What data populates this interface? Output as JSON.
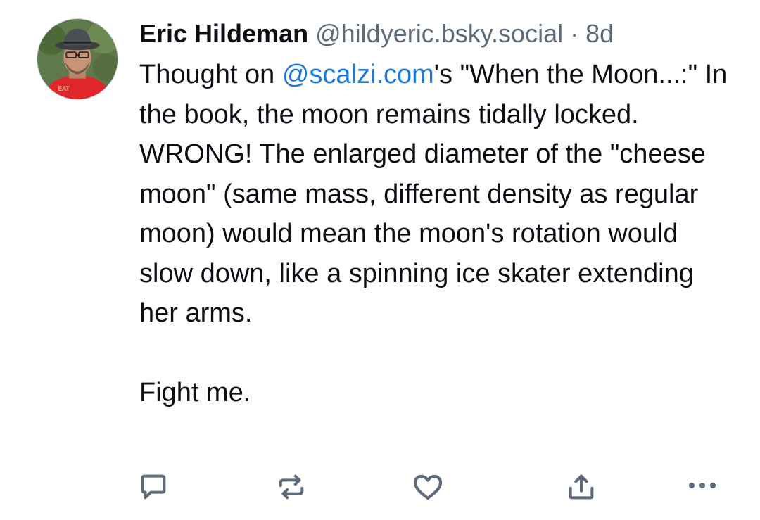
{
  "post": {
    "author": {
      "display_name": "Eric Hildeman",
      "handle": "@hildyeric.bsky.social",
      "separator": "·",
      "time": "8d"
    },
    "body": {
      "part1": "Thought on ",
      "mention": "@scalzi.com",
      "part2": "'s \"When the Moon...:\" In the book, the moon remains tidally locked. WRONG! The enlarged diameter of the \"cheese moon\" (same mass, different density as regular moon) would mean the moon's rotation would slow down, like a spinning ice skater extending her arms.",
      "part3": "Fight me."
    },
    "actions": [
      {
        "name": "reply",
        "icon": "speech-bubble-icon"
      },
      {
        "name": "repost",
        "icon": "repost-arrows-icon"
      },
      {
        "name": "like",
        "icon": "heart-icon"
      },
      {
        "name": "share",
        "icon": "share-upload-icon"
      },
      {
        "name": "more",
        "icon": "ellipsis-icon"
      }
    ],
    "colors": {
      "text": "#0b0f14",
      "muted": "#5b6b7b",
      "link": "#1d7ad8",
      "icon": "#5b6b7b"
    }
  }
}
